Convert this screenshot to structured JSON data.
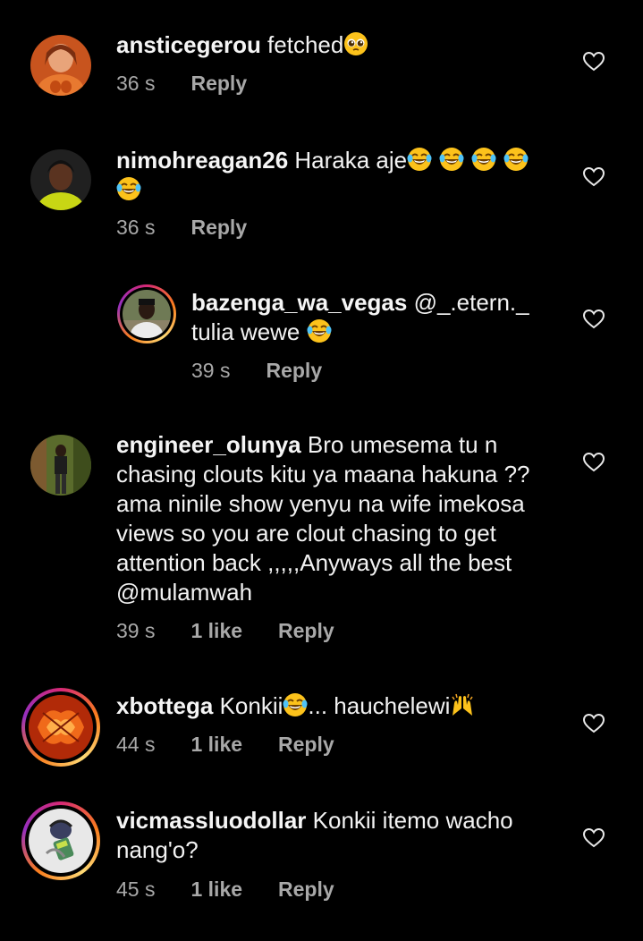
{
  "comments": [
    {
      "username": "ansticegerou",
      "text": " fetched",
      "emoji": "pleading-face-emoji",
      "time": "36 s",
      "likes": "",
      "reply_label": "Reply"
    },
    {
      "username": "nimohreagan26",
      "text": " Haraka aje",
      "emoji": "laughing-tears-emoji",
      "time": "36 s",
      "likes": "",
      "reply_label": "Reply"
    },
    {
      "username": "bazenga_wa_vegas",
      "text_line1": " @_.etern._",
      "text_line2": "tulia wewe ",
      "emoji": "laughing-tears-emoji",
      "time": "39 s",
      "likes": "",
      "reply_label": "Reply"
    },
    {
      "username": "engineer_olunya",
      "text_line1": " Bro umesema tu n",
      "text_line2": "chasing clouts kitu ya maana hakuna ??",
      "text_line3": "ama ninile show yenyu na wife imekosa",
      "text_line4": "views so you are clout chasing to get",
      "text_line5": "attention back ,,,,,Anyways all the best",
      "text_line6": "@mulamwah",
      "time": "39 s",
      "likes": "1 like",
      "reply_label": "Reply"
    },
    {
      "username": "xbottega",
      "text_part1": " Konkii",
      "text_part2": "... hauchelewi",
      "emoji1": "laughing-tears-emoji",
      "emoji2": "raised-hands-emoji",
      "time": "44 s",
      "likes": "1 like",
      "reply_label": "Reply"
    },
    {
      "username": "vicmassluodollar",
      "text_line1": " Konkii itemo wacho",
      "text_line2": "nang'o?",
      "time": "45 s",
      "likes": "1 like",
      "reply_label": "Reply"
    }
  ],
  "colors": {
    "background": "#000000",
    "text": "#f2f2f2",
    "meta": "#a8a8a8"
  }
}
